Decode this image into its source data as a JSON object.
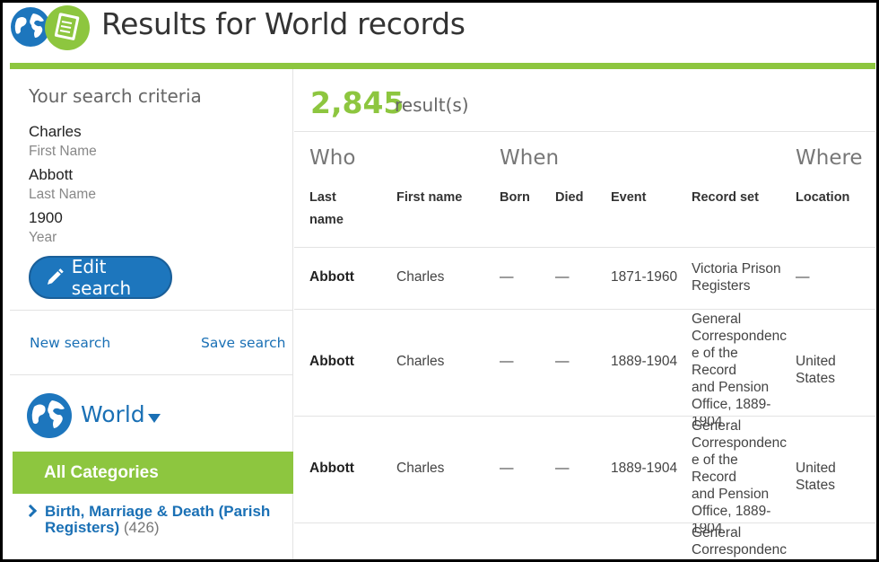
{
  "header": {
    "title": "Results for World records",
    "logo_globe_icon": "globe-icon",
    "logo_book_icon": "book-icon"
  },
  "sidebar": {
    "criteria_title": "Your search criteria",
    "criteria": [
      {
        "value": "Charles",
        "label": "First Name"
      },
      {
        "value": "Abbott",
        "label": "Last Name"
      },
      {
        "value": "1900",
        "label": "Year"
      }
    ],
    "edit_label": "Edit search",
    "new_search_label": "New search",
    "save_search_label": "Save search",
    "world_label": "World",
    "all_categories_label": "All Categories",
    "categories": [
      {
        "name": "Birth, Marriage & Death (Parish Registers)",
        "count": "(426)"
      }
    ]
  },
  "results": {
    "count": "2,845",
    "count_suffix": "result(s)",
    "groups": {
      "who": "Who",
      "when": "When",
      "where": "Where"
    },
    "columns": {
      "last_name": "Last name",
      "first_name": "First name",
      "born": "Born",
      "died": "Died",
      "event": "Event",
      "record_set": "Record set",
      "location": "Location"
    },
    "rows": [
      {
        "last_name": "Abbott",
        "first_name": "Charles",
        "born": "—",
        "died": "—",
        "event": "1871-1960",
        "record_set": [
          "Victoria Prison",
          "Registers"
        ],
        "location": "—"
      },
      {
        "last_name": "Abbott",
        "first_name": "Charles",
        "born": "—",
        "died": "—",
        "event": "1889-1904",
        "record_set": [
          "General",
          "Correspondenc",
          "e of the Record",
          "and Pension",
          "Office, 1889-",
          "1904"
        ],
        "location": "United States"
      },
      {
        "last_name": "Abbott",
        "first_name": "Charles",
        "born": "—",
        "died": "—",
        "event": "1889-1904",
        "record_set": [
          "General",
          "Correspondenc",
          "e of the Record",
          "and Pension",
          "Office, 1889-",
          "1904"
        ],
        "location": "United States"
      },
      {
        "last_name": "",
        "first_name": "",
        "born": "",
        "died": "",
        "event": "",
        "record_set": [
          "General",
          "Correspondenc"
        ],
        "location": ""
      }
    ]
  },
  "colors": {
    "accent_green": "#8dc63f",
    "link_blue": "#1a70b5",
    "button_blue": "#1d76bd"
  }
}
